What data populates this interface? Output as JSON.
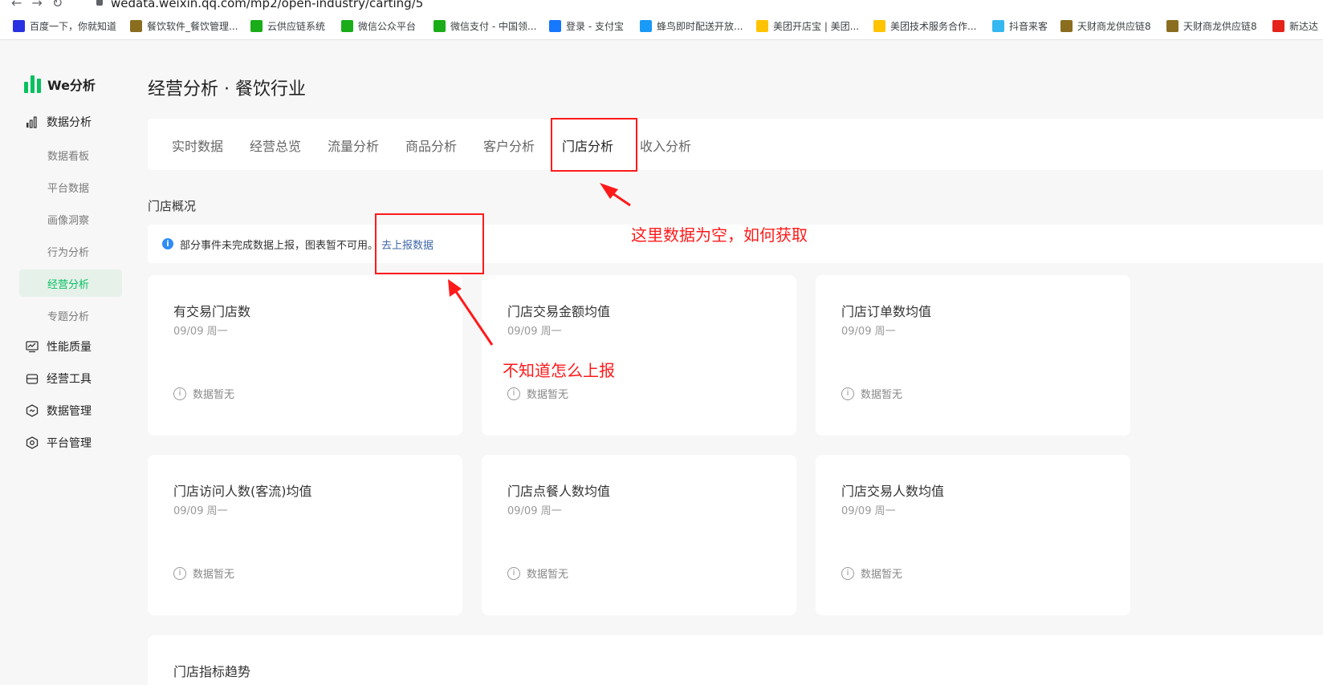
{
  "browser": {
    "url": "wedata.weixin.qq.com/mp2/open-industry/carting/5",
    "bookmarks": [
      {
        "label": "百度一下，你就知道",
        "icon": "baidu-icon",
        "color": "#2932e1"
      },
      {
        "label": "餐饮软件_餐饮管理...",
        "icon": "restaurant-icon",
        "color": "#8a6d1f"
      },
      {
        "label": "云供应链系统",
        "icon": "cloud-icon",
        "color": "#1aad19"
      },
      {
        "label": "微信公众平台",
        "icon": "wechat-icon",
        "color": "#1aad19"
      },
      {
        "label": "微信支付 - 中国领...",
        "icon": "wechat-pay-icon",
        "color": "#1aad19"
      },
      {
        "label": "登录 - 支付宝",
        "icon": "alipay-icon",
        "color": "#1677ff"
      },
      {
        "label": "蜂鸟即时配送开放...",
        "icon": "fengniao-icon",
        "color": "#1a9af7"
      },
      {
        "label": "美团开店宝 | 美团...",
        "icon": "meituan-icon",
        "color": "#ffc300"
      },
      {
        "label": "美团技术服务合作...",
        "icon": "meituan-tech-icon",
        "color": "#ffc300"
      },
      {
        "label": "抖音来客",
        "icon": "douyin-icon",
        "color": "#35b8f0"
      },
      {
        "label": "天财商龙供应链8",
        "icon": "tiancai-icon",
        "color": "#8a6d1f"
      },
      {
        "label": "天财商龙供应链8",
        "icon": "tiancai-icon",
        "color": "#8a6d1f"
      },
      {
        "label": "新达达",
        "icon": "dada-icon",
        "color": "#e4231a"
      }
    ]
  },
  "sidebar": {
    "logo": "We分析",
    "brand_color": "#07c160",
    "items": [
      {
        "label": "数据分析",
        "icon": "bar-chart-icon"
      },
      {
        "label": "性能质量",
        "icon": "monitor-icon"
      },
      {
        "label": "经营工具",
        "icon": "toolbox-icon"
      },
      {
        "label": "数据管理",
        "icon": "data-hexagon-icon"
      },
      {
        "label": "平台管理",
        "icon": "settings-hexagon-icon"
      }
    ],
    "subitems": [
      "数据看板",
      "平台数据",
      "画像洞察",
      "行为分析",
      "经营分析",
      "专题分析"
    ],
    "active_subitem": "经营分析"
  },
  "main": {
    "title": "经营分析 · 餐饮行业",
    "tabs": [
      "实时数据",
      "经营总览",
      "流量分析",
      "商品分析",
      "客户分析",
      "门店分析",
      "收入分析"
    ],
    "active_tab": "门店分析",
    "section_title": "门店概况",
    "notice": {
      "text": "部分事件未完成数据上报，图表暂不可用。",
      "link": "去上报数据"
    },
    "cards": [
      {
        "title": "有交易门店数",
        "date": "09/09 周一",
        "empty": "数据暂无"
      },
      {
        "title": "门店交易金额均值",
        "date": "09/09 周一",
        "empty": "数据暂无"
      },
      {
        "title": "门店订单数均值",
        "date": "09/09 周一",
        "empty": "数据暂无"
      },
      {
        "title": "门店访问人数(客流)均值",
        "date": "09/09 周一",
        "empty": "数据暂无"
      },
      {
        "title": "门店点餐人数均值",
        "date": "09/09 周一",
        "empty": "数据暂无"
      },
      {
        "title": "门店交易人数均值",
        "date": "09/09 周一",
        "empty": "数据暂无"
      }
    ],
    "trend_title": "门店指标趋势"
  },
  "annotations": {
    "color": "#ff1a1a",
    "empty_data_note": "这里数据为空，如何获取",
    "report_note": "不知道怎么上报"
  }
}
